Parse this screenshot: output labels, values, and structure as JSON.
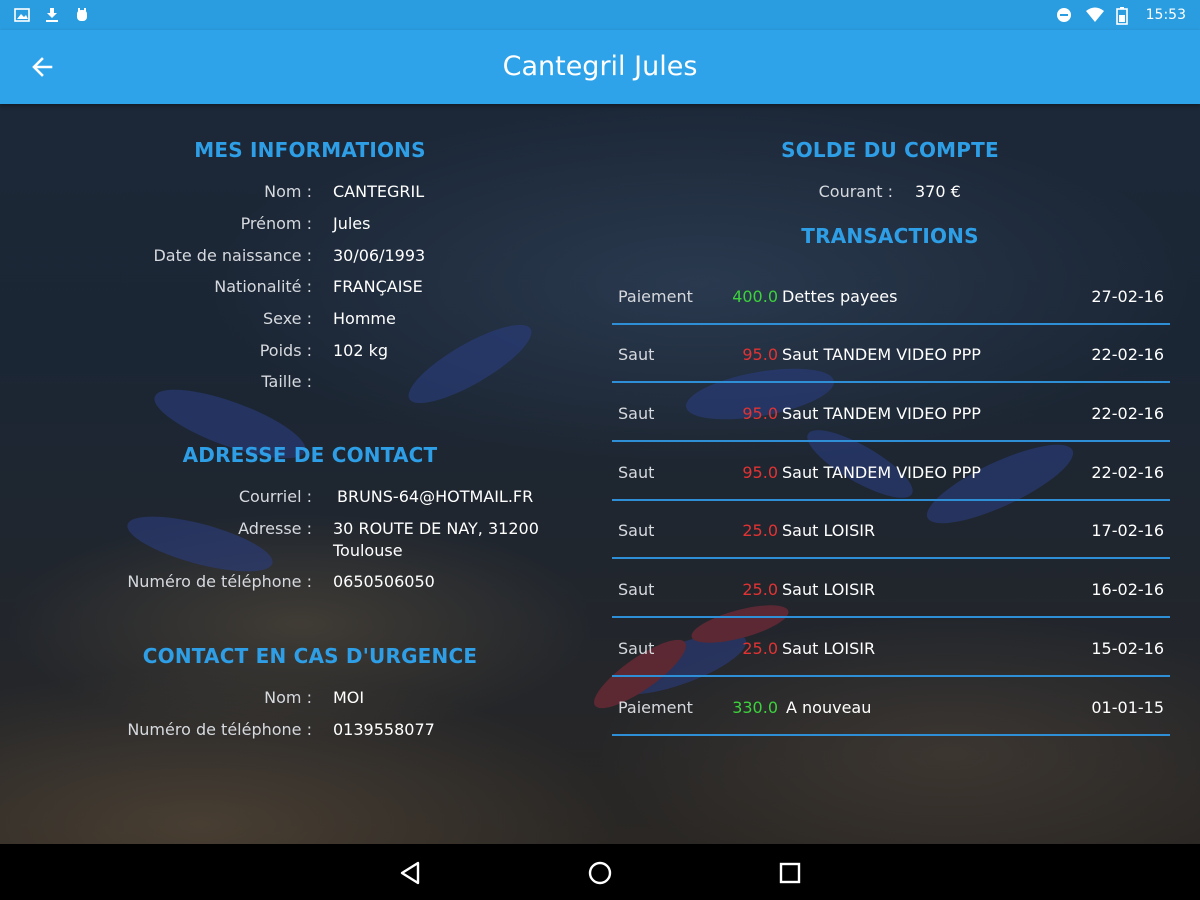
{
  "status_bar": {
    "time": "15:53",
    "left_icons": [
      "image-icon",
      "download-icon",
      "bug-icon"
    ],
    "right_icons": [
      "do-not-disturb-icon",
      "wifi-icon",
      "battery-icon"
    ]
  },
  "app_bar": {
    "title": "Cantegril Jules",
    "back_icon": "arrow-back-icon"
  },
  "mes_informations": {
    "title": "MES INFORMATIONS",
    "rows": [
      {
        "label": "Nom :",
        "value": "CANTEGRIL"
      },
      {
        "label": "Prénom :",
        "value": "Jules"
      },
      {
        "label": "Date de naissance :",
        "value": "30/06/1993"
      },
      {
        "label": "Nationalité :",
        "value": "FRANÇAISE"
      },
      {
        "label": "Sexe :",
        "value": "Homme"
      },
      {
        "label": "Poids :",
        "value": "102 kg"
      },
      {
        "label": "Taille :",
        "value": ""
      }
    ]
  },
  "adresse_contact": {
    "title": "ADRESSE DE CONTACT",
    "rows": [
      {
        "label": "Courriel :",
        "value": "BRUNS-64@HOTMAIL.FR"
      },
      {
        "label": "Adresse :",
        "value": "30 ROUTE DE NAY, 31200",
        "value2": "Toulouse"
      },
      {
        "label": "Numéro de téléphone :",
        "value": "0650506050"
      }
    ]
  },
  "contact_urgence": {
    "title": "CONTACT EN CAS D'URGENCE",
    "rows": [
      {
        "label": "Nom :",
        "value": "MOI"
      },
      {
        "label": "Numéro de téléphone :",
        "value": "0139558077"
      }
    ]
  },
  "solde": {
    "title": "SOLDE DU COMPTE",
    "label": "Courant :",
    "value": "370 €"
  },
  "transactions": {
    "title": "TRANSACTIONS",
    "rows": [
      {
        "type": "Paiement",
        "amount": "400.0",
        "sign": "pos",
        "desc": "Dettes payees",
        "date": "27-02-16"
      },
      {
        "type": "Saut",
        "amount": "95.0",
        "sign": "neg",
        "desc": "Saut TANDEM VIDEO PPP",
        "date": "22-02-16"
      },
      {
        "type": "Saut",
        "amount": "95.0",
        "sign": "neg",
        "desc": "Saut TANDEM VIDEO PPP",
        "date": "22-02-16"
      },
      {
        "type": "Saut",
        "amount": "95.0",
        "sign": "neg",
        "desc": "Saut TANDEM VIDEO PPP",
        "date": "22-02-16"
      },
      {
        "type": "Saut",
        "amount": "25.0",
        "sign": "neg",
        "desc": "Saut LOISIR",
        "date": "17-02-16"
      },
      {
        "type": "Saut",
        "amount": "25.0",
        "sign": "neg",
        "desc": "Saut LOISIR",
        "date": "16-02-16"
      },
      {
        "type": "Saut",
        "amount": "25.0",
        "sign": "neg",
        "desc": "Saut LOISIR",
        "date": "15-02-16"
      },
      {
        "type": "Paiement",
        "amount": "330.0",
        "sign": "pos",
        "desc": "A nouveau",
        "date": "01-01-15"
      }
    ]
  },
  "colors": {
    "app_bar": "#2ea3ea",
    "status_bar": "#2a9de0",
    "section_title": "#2e9fe6",
    "positive_amount": "#3cd23c",
    "negative_amount": "#e23333",
    "divider": "#2e8fd6"
  },
  "nav_bar": {
    "icons": [
      "nav-back-icon",
      "nav-home-icon",
      "nav-recents-icon"
    ]
  }
}
